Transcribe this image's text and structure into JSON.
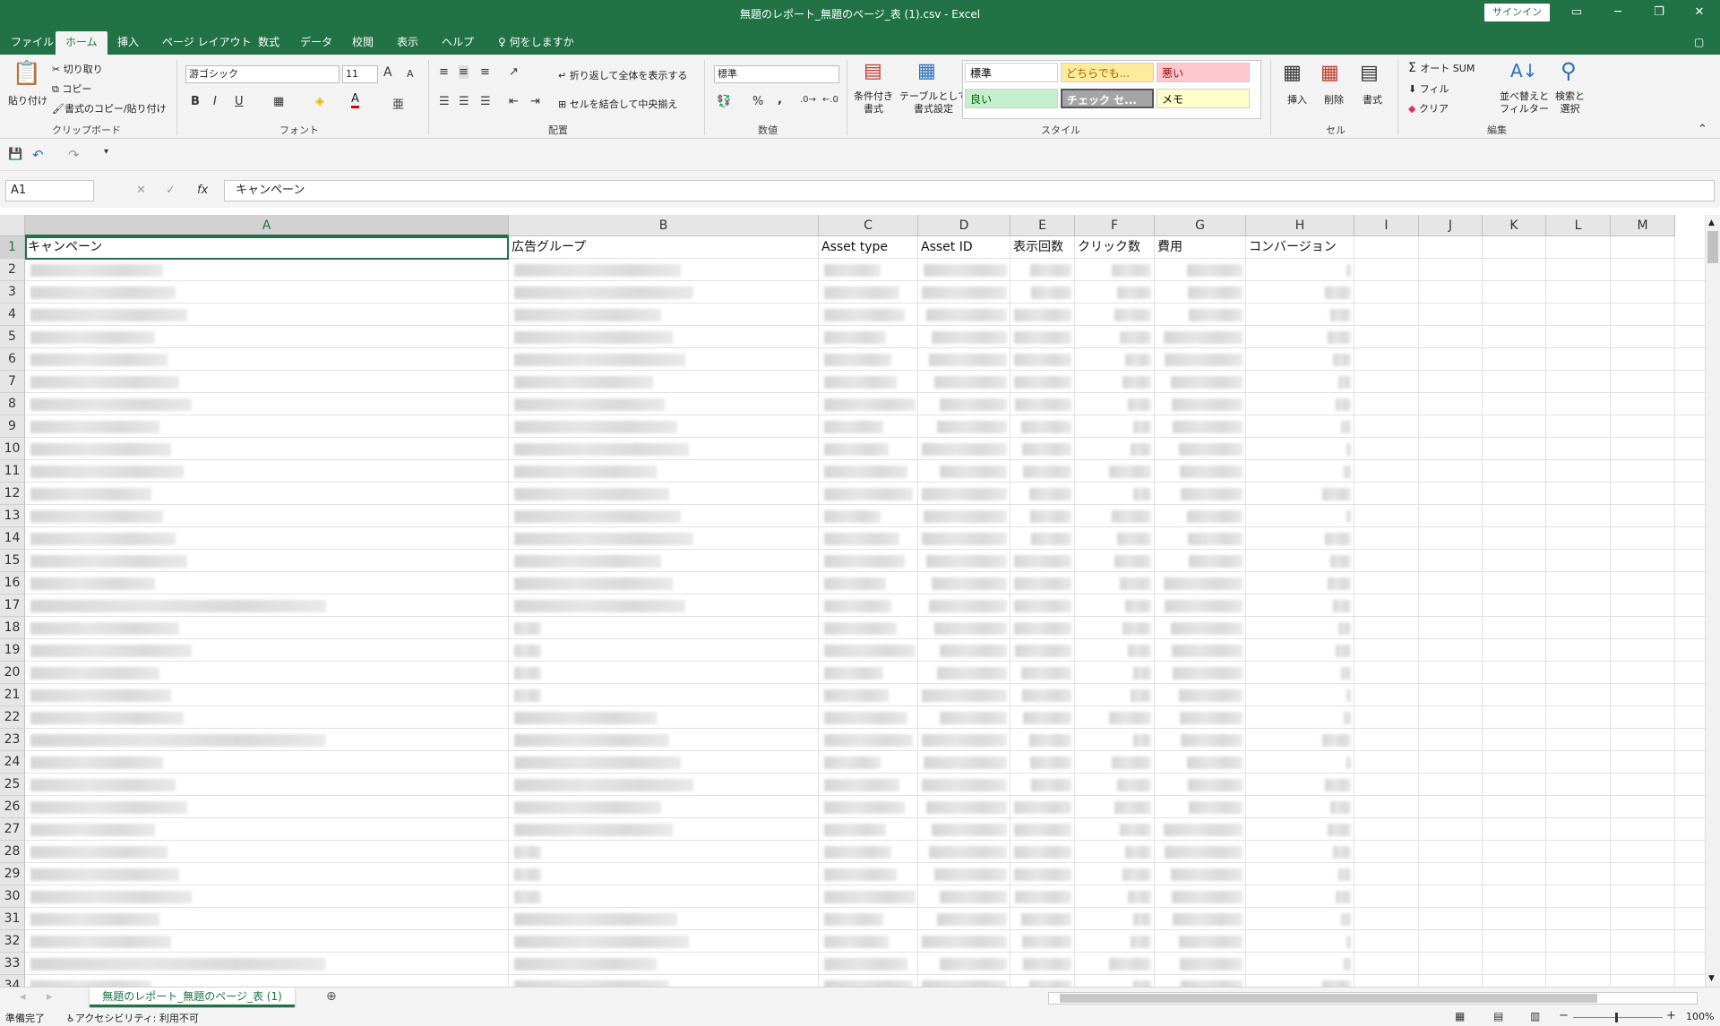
{
  "window": {
    "title": "無題のレポート_無題のページ_表 (1).csv  -  Excel",
    "signin": "サインイン",
    "icons": [
      "ribbon-display-icon",
      "minimize-icon",
      "restore-icon",
      "close-icon"
    ]
  },
  "tabs": [
    {
      "label": "ファイル"
    },
    {
      "label": "ホーム",
      "active": true
    },
    {
      "label": "挿入"
    },
    {
      "label": "ページ レイアウト"
    },
    {
      "label": "数式"
    },
    {
      "label": "データ"
    },
    {
      "label": "校閲"
    },
    {
      "label": "表示"
    },
    {
      "label": "ヘルプ"
    },
    {
      "label": "何をしますか"
    }
  ],
  "ribbon": {
    "clipboard": {
      "paste": "貼り付け",
      "cut": "切り取り",
      "copy": "コピー",
      "format_painter": "書式のコピー/貼り付け",
      "label": "クリップボード"
    },
    "font": {
      "name": "游ゴシック",
      "size": "11",
      "label": "フォント",
      "bold": "B",
      "italic": "I",
      "underline": "U",
      "font_color_glyph": "A",
      "grow_glyph": "A",
      "shrink_glyph": "A"
    },
    "alignment": {
      "wrap": "折り返して全体を表示する",
      "merge": "セルを結合して中央揃え",
      "label": "配置"
    },
    "number": {
      "format": "標準",
      "percent": "%",
      "comma": ",",
      "label": "数値"
    },
    "styles": {
      "conditional": "条件付き\n書式",
      "table": "テーブルとして\n書式設定",
      "label": "スタイル",
      "cells": [
        {
          "label": "標準",
          "bg": "#ffffff",
          "color": "#000000"
        },
        {
          "label": "どちらでも...",
          "bg": "#ffeb9c",
          "color": "#9c6500"
        },
        {
          "label": "悪い",
          "bg": "#ffc7ce",
          "color": "#9c0006"
        },
        {
          "label": "良い",
          "bg": "#c6efce",
          "color": "#006100"
        },
        {
          "label": "チェック セ...",
          "bg": "#a5a5a5",
          "color": "#ffffff"
        },
        {
          "label": "メモ",
          "bg": "#ffffcc",
          "color": "#000000"
        }
      ]
    },
    "cells": {
      "insert": "挿入",
      "delete": "削除",
      "format": "書式",
      "label": "セル"
    },
    "editing": {
      "autosum": "オート SUM",
      "fill": "フィル",
      "clear": "クリア",
      "sort": "並べ替えと\nフィルター",
      "find": "検索と\n選択",
      "label": "編集"
    }
  },
  "formula_bar": {
    "name_box": "A1",
    "value": "キャンペーン",
    "fx": "fx"
  },
  "columns": [
    "A",
    "B",
    "C",
    "D",
    "E",
    "F",
    "G",
    "H",
    "I",
    "J",
    "K",
    "L",
    "M"
  ],
  "header_row": [
    "キャンペーン",
    "広告グループ",
    "Asset type",
    "Asset ID",
    "表示回数",
    "クリック数",
    "費用",
    "コンバージョン"
  ],
  "row_numbers": [
    "1",
    "2",
    "3",
    "4",
    "5",
    "6",
    "7",
    "8",
    "9",
    "10",
    "11",
    "12",
    "13",
    "14",
    "15",
    "16",
    "17",
    "18",
    "19",
    "20",
    "21",
    "22",
    "23",
    "24",
    "25",
    "26",
    "27",
    "28",
    "29",
    "30",
    "31",
    "32",
    "33",
    "34"
  ],
  "sheet_tab": "無題のレポート_無題のページ_表 (1)",
  "status": {
    "ready": "準備完了",
    "accessibility": "アクセシビリティ: 利用不可",
    "zoom": "100%"
  }
}
